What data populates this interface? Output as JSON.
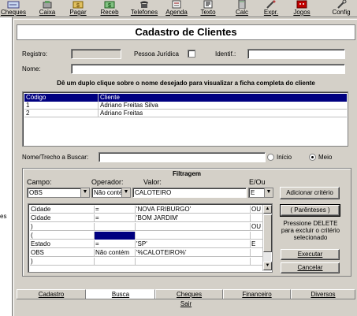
{
  "toolbar": {
    "buttons": [
      {
        "label": "Cheques",
        "icon": "checks-icon"
      },
      {
        "label": "Caixa",
        "icon": "cash-register-icon"
      },
      {
        "label": "Pagar",
        "icon": "pay-icon"
      },
      {
        "label": "Receb",
        "icon": "receive-icon"
      },
      {
        "label": "Telefones",
        "icon": "phone-icon"
      },
      {
        "label": "Agenda",
        "icon": "agenda-icon"
      },
      {
        "label": "Texto",
        "icon": "text-icon"
      },
      {
        "label": "Calc",
        "icon": "calculator-icon"
      },
      {
        "label": "Expr.",
        "icon": "expression-icon"
      },
      {
        "label": "Jogos",
        "icon": "games-icon"
      },
      {
        "label": "Config",
        "icon": "config-icon"
      }
    ]
  },
  "left_strip": {
    "text": "es"
  },
  "form": {
    "title": "Cadastro de Clientes",
    "registro_label": "Registro:",
    "registro_value": "",
    "pessoa_juridica_label": "Pessoa Jurídica",
    "identif_label": "Identif.:",
    "identif_value": "",
    "nome_label": "Nome:",
    "nome_value": "",
    "instruction": "Dê um duplo clique sobre o nome desejado para visualizar a ficha completa do cliente"
  },
  "client_grid": {
    "headers": [
      "Código",
      "Cliente"
    ],
    "rows": [
      {
        "codigo": "1",
        "cliente": "Adriano Freitas Silva"
      },
      {
        "codigo": "2",
        "cliente": "Adriano Freitas"
      }
    ]
  },
  "search": {
    "label": "Nome/Trecho a Buscar:",
    "value": "",
    "option_inicio": "Início",
    "option_meio": "Meio",
    "selected": "Meio"
  },
  "filter": {
    "title": "Filtragem",
    "campo_label": "Campo:",
    "operador_label": "Operador:",
    "valor_label": "Valor:",
    "eou_label": "E/Ou",
    "campo_value": "OBS",
    "operador_value": "Não contém",
    "valor_value": "CALOTEIRO",
    "eou_value": "E",
    "add_button": "Adicionar critério",
    "parenteses_button": "( Parênteses )",
    "delete_hint": "Pressione DELETE para excluir o critério selecionado",
    "executar_button": "Executar",
    "cancelar_button": "Cancelar",
    "rows": [
      {
        "campo": "Cidade",
        "operador": "=",
        "valor": "'NOVA FRIBURGO'",
        "eou": "OU"
      },
      {
        "campo": "Cidade",
        "operador": "=",
        "valor": "'BOM JARDIM'",
        "eou": ""
      },
      {
        "campo": ")",
        "operador": "",
        "valor": "",
        "eou": "OU"
      },
      {
        "campo": "(",
        "operador": "",
        "valor": "",
        "eou": ""
      },
      {
        "campo": "Estado",
        "operador": "=",
        "valor": "'SP'",
        "eou": "E"
      },
      {
        "campo": "OBS",
        "operador": "Não contém",
        "valor": "'%CALOTEIRO%'",
        "eou": ""
      },
      {
        "campo": ")",
        "operador": "",
        "valor": "",
        "eou": ""
      }
    ]
  },
  "tabs": {
    "items": [
      "Cadastro",
      "Busca",
      "Cheques",
      "Financeiro",
      "Diversos"
    ],
    "active": "Busca"
  },
  "footer": {
    "sair": "Sair"
  },
  "colors": {
    "selection": "#000080",
    "panel": "#d4d0c8"
  }
}
